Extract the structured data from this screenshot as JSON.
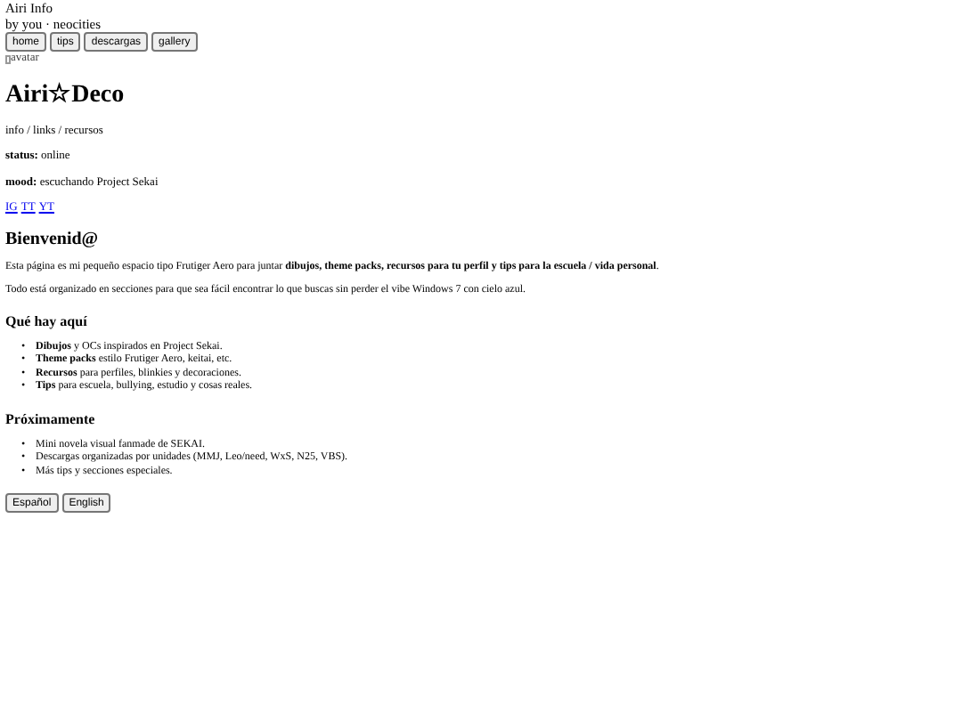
{
  "header": {
    "title": "Airi Info",
    "byline": "by you · neocities"
  },
  "nav": [
    "home",
    "tips",
    "descargas",
    "gallery"
  ],
  "avatar_alt": "avatar",
  "profile": {
    "name": "Airi☆Deco",
    "tagline": "info / links / recursos",
    "fields": [
      {
        "label": "status:",
        "value": "online"
      },
      {
        "label": "mood:",
        "value": "escuchando Project Sekai"
      }
    ],
    "links": [
      "IG",
      "TT",
      "YT"
    ]
  },
  "welcome": {
    "heading": "Bienvenid@",
    "paragraphs": [
      "Esta página es mi pequeño espacio tipo Frutiger Aero para juntar **dibujos, theme packs, recursos para tu perfil y tips para la escuela / vida personal**.",
      "Todo está organizado en secciones para que sea fácil encontrar lo que buscas sin perder el vibe Windows 7 con cielo azul."
    ]
  },
  "sections": [
    {
      "heading": "Qué hay aquí",
      "marker": "•",
      "items": [
        "**Dibujos** y OCs inspirados en Project Sekai.",
        "**Theme packs** estilo Frutiger Aero, keitai, etc.",
        "**Recursos** para perfiles, blinkies y decoraciones.",
        "**Tips** para escuela, bullying, estudio y cosas reales."
      ]
    },
    {
      "heading": "Próximamente",
      "marker": "•",
      "items": [
        "Mini novela visual fanmade de SEKAI.",
        "Descargas organizadas por unidades (MMJ, Leo/need, WxS, N25, VBS).",
        "Más tips y secciones especiales."
      ]
    }
  ],
  "languages": [
    "Español",
    "English"
  ]
}
